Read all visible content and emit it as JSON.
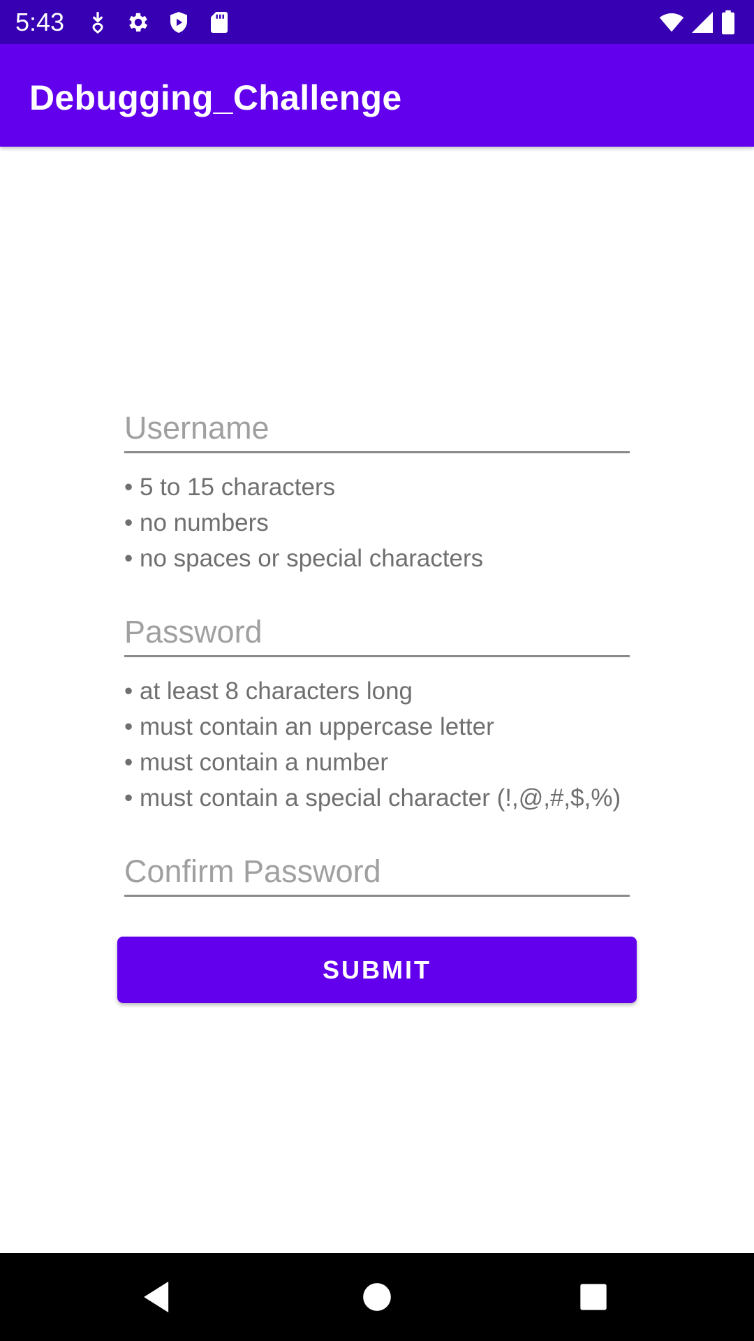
{
  "status_bar": {
    "time": "5:43",
    "left_icons": [
      "download-icon",
      "settings-icon",
      "shield-play-icon",
      "sd-card-icon"
    ],
    "right_icons": [
      "wifi-icon",
      "signal-icon",
      "battery-icon"
    ]
  },
  "app_bar": {
    "title": "Debugging_Challenge",
    "background_color": "#6200EE"
  },
  "form": {
    "username": {
      "placeholder": "Username",
      "value": "",
      "hints": [
        "• 5 to 15 characters",
        "• no numbers",
        "• no spaces or special characters"
      ]
    },
    "password": {
      "placeholder": "Password",
      "value": "",
      "hints": [
        "• at least 8 characters long",
        "• must contain an uppercase letter",
        "• must contain a number",
        "• must contain a special character (!,@,#,$,%)"
      ]
    },
    "confirm_password": {
      "placeholder": "Confirm Password",
      "value": ""
    },
    "submit_label": "SUBMIT"
  },
  "nav_bar": {
    "buttons": [
      "back-icon",
      "home-icon",
      "recents-icon"
    ]
  }
}
